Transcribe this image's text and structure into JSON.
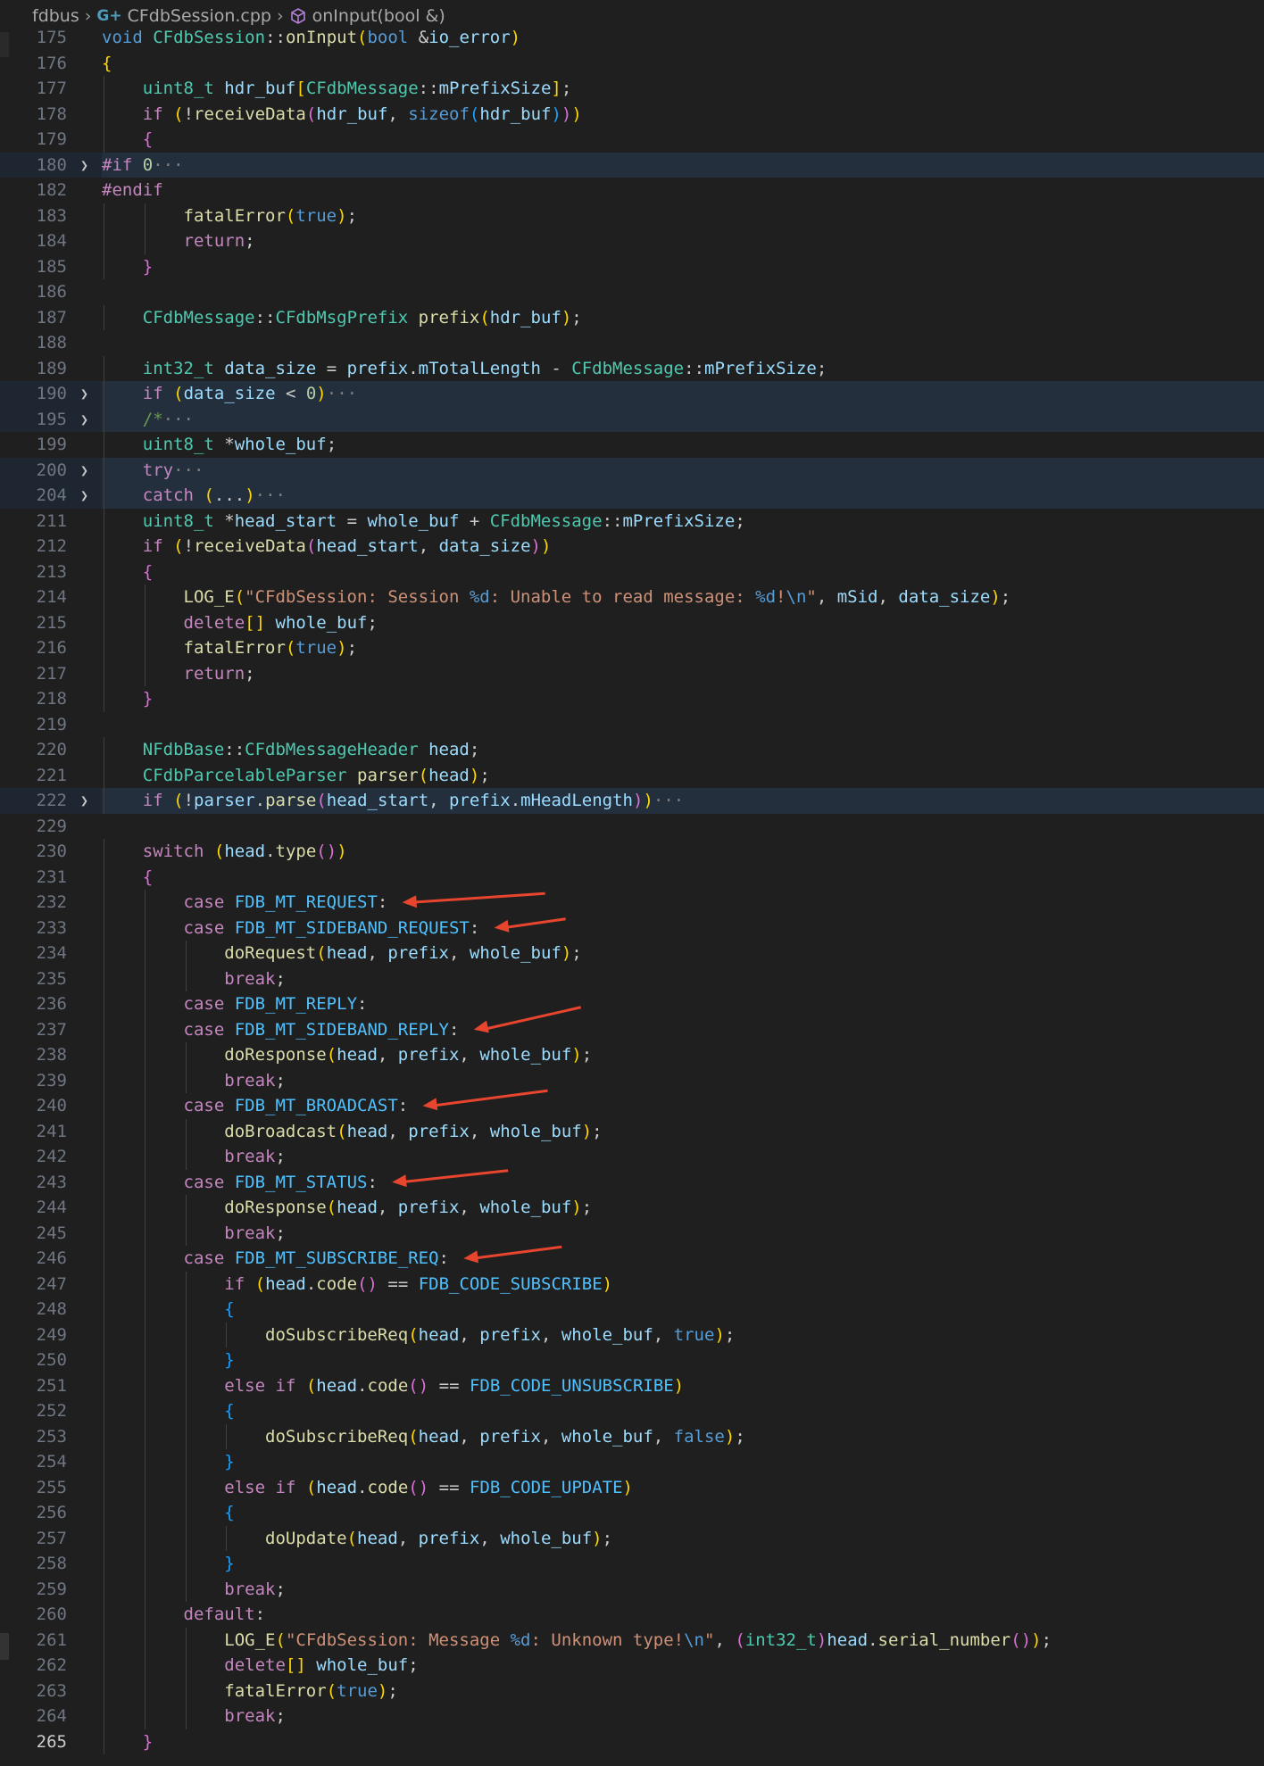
{
  "breadcrumb": {
    "folder": "fdbus",
    "file": "CFdbSession.cpp",
    "symbol": "onInput(bool &)"
  },
  "icons": {
    "file_icon": "c-plus-plus-file-icon",
    "symbol_icon": "method-cube-icon",
    "fold_icon": "chevron-right-icon"
  },
  "colors": {
    "background": "#1f1f1f",
    "keyword": "#c586c0",
    "type": "#4ec9b0",
    "function": "#dcdcaa",
    "string": "#ce9178",
    "annotation_arrow": "#e8452e"
  },
  "lines": [
    {
      "n": "175",
      "code": "void CFdbSession::onInput(bool &io_error)"
    },
    {
      "n": "176",
      "code": "{"
    },
    {
      "n": "177",
      "code": "    uint8_t hdr_buf[CFdbMessage::mPrefixSize];"
    },
    {
      "n": "178",
      "code": "    if (!receiveData(hdr_buf, sizeof(hdr_buf)))"
    },
    {
      "n": "179",
      "code": "    {"
    },
    {
      "n": "180",
      "code": "#if 0···"
    },
    {
      "n": "182",
      "code": "#endif"
    },
    {
      "n": "183",
      "code": "        fatalError(true);"
    },
    {
      "n": "184",
      "code": "        return;"
    },
    {
      "n": "185",
      "code": "    }"
    },
    {
      "n": "186",
      "code": ""
    },
    {
      "n": "187",
      "code": "    CFdbMessage::CFdbMsgPrefix prefix(hdr_buf);"
    },
    {
      "n": "188",
      "code": ""
    },
    {
      "n": "189",
      "code": "    int32_t data_size = prefix.mTotalLength - CFdbMessage::mPrefixSize;"
    },
    {
      "n": "190",
      "code": "    if (data_size < 0)···"
    },
    {
      "n": "195",
      "code": "    /*···"
    },
    {
      "n": "199",
      "code": "    uint8_t *whole_buf;"
    },
    {
      "n": "200",
      "code": "    try···"
    },
    {
      "n": "204",
      "code": "    catch (...)···"
    },
    {
      "n": "211",
      "code": "    uint8_t *head_start = whole_buf + CFdbMessage::mPrefixSize;"
    },
    {
      "n": "212",
      "code": "    if (!receiveData(head_start, data_size))"
    },
    {
      "n": "213",
      "code": "    {"
    },
    {
      "n": "214",
      "code": "        LOG_E(\"CFdbSession: Session %d: Unable to read message: %d!\\n\", mSid, data_size);"
    },
    {
      "n": "215",
      "code": "        delete[] whole_buf;"
    },
    {
      "n": "216",
      "code": "        fatalError(true);"
    },
    {
      "n": "217",
      "code": "        return;"
    },
    {
      "n": "218",
      "code": "    }"
    },
    {
      "n": "219",
      "code": ""
    },
    {
      "n": "220",
      "code": "    NFdbBase::CFdbMessageHeader head;"
    },
    {
      "n": "221",
      "code": "    CFdbParcelableParser parser(head);"
    },
    {
      "n": "222",
      "code": "    if (!parser.parse(head_start, prefix.mHeadLength))···"
    },
    {
      "n": "229",
      "code": ""
    },
    {
      "n": "230",
      "code": "    switch (head.type())"
    },
    {
      "n": "231",
      "code": "    {"
    },
    {
      "n": "232",
      "code": "        case FDB_MT_REQUEST:"
    },
    {
      "n": "233",
      "code": "        case FDB_MT_SIDEBAND_REQUEST:"
    },
    {
      "n": "234",
      "code": "            doRequest(head, prefix, whole_buf);"
    },
    {
      "n": "235",
      "code": "            break;"
    },
    {
      "n": "236",
      "code": "        case FDB_MT_REPLY:"
    },
    {
      "n": "237",
      "code": "        case FDB_MT_SIDEBAND_REPLY:"
    },
    {
      "n": "238",
      "code": "            doResponse(head, prefix, whole_buf);"
    },
    {
      "n": "239",
      "code": "            break;"
    },
    {
      "n": "240",
      "code": "        case FDB_MT_BROADCAST:"
    },
    {
      "n": "241",
      "code": "            doBroadcast(head, prefix, whole_buf);"
    },
    {
      "n": "242",
      "code": "            break;"
    },
    {
      "n": "243",
      "code": "        case FDB_MT_STATUS:"
    },
    {
      "n": "244",
      "code": "            doResponse(head, prefix, whole_buf);"
    },
    {
      "n": "245",
      "code": "            break;"
    },
    {
      "n": "246",
      "code": "        case FDB_MT_SUBSCRIBE_REQ:"
    },
    {
      "n": "247",
      "code": "            if (head.code() == FDB_CODE_SUBSCRIBE)"
    },
    {
      "n": "248",
      "code": "            {"
    },
    {
      "n": "249",
      "code": "                doSubscribeReq(head, prefix, whole_buf, true);"
    },
    {
      "n": "250",
      "code": "            }"
    },
    {
      "n": "251",
      "code": "            else if (head.code() == FDB_CODE_UNSUBSCRIBE)"
    },
    {
      "n": "252",
      "code": "            {"
    },
    {
      "n": "253",
      "code": "                doSubscribeReq(head, prefix, whole_buf, false);"
    },
    {
      "n": "254",
      "code": "            }"
    },
    {
      "n": "255",
      "code": "            else if (head.code() == FDB_CODE_UPDATE)"
    },
    {
      "n": "256",
      "code": "            {"
    },
    {
      "n": "257",
      "code": "                doUpdate(head, prefix, whole_buf);"
    },
    {
      "n": "258",
      "code": "            }"
    },
    {
      "n": "259",
      "code": "            break;"
    },
    {
      "n": "260",
      "code": "        default:"
    },
    {
      "n": "261",
      "code": "            LOG_E(\"CFdbSession: Message %d: Unknown type!\\n\", (int32_t)head.serial_number());"
    },
    {
      "n": "262",
      "code": "            delete[] whole_buf;"
    },
    {
      "n": "263",
      "code": "            fatalError(true);"
    },
    {
      "n": "264",
      "code": "            break;"
    },
    {
      "n": "265",
      "code": "    }"
    }
  ]
}
